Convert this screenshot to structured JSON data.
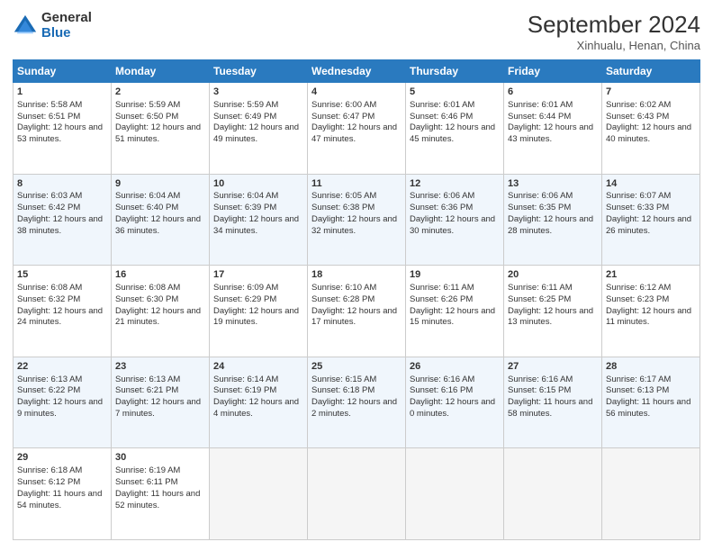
{
  "header": {
    "logo_general": "General",
    "logo_blue": "Blue",
    "month_title": "September 2024",
    "subtitle": "Xinhualu, Henan, China"
  },
  "days_of_week": [
    "Sunday",
    "Monday",
    "Tuesday",
    "Wednesday",
    "Thursday",
    "Friday",
    "Saturday"
  ],
  "weeks": [
    [
      {
        "day": "1",
        "sunrise": "5:58 AM",
        "sunset": "6:51 PM",
        "daylight": "12 hours and 53 minutes."
      },
      {
        "day": "2",
        "sunrise": "5:59 AM",
        "sunset": "6:50 PM",
        "daylight": "12 hours and 51 minutes."
      },
      {
        "day": "3",
        "sunrise": "5:59 AM",
        "sunset": "6:49 PM",
        "daylight": "12 hours and 49 minutes."
      },
      {
        "day": "4",
        "sunrise": "6:00 AM",
        "sunset": "6:47 PM",
        "daylight": "12 hours and 47 minutes."
      },
      {
        "day": "5",
        "sunrise": "6:01 AM",
        "sunset": "6:46 PM",
        "daylight": "12 hours and 45 minutes."
      },
      {
        "day": "6",
        "sunrise": "6:01 AM",
        "sunset": "6:44 PM",
        "daylight": "12 hours and 43 minutes."
      },
      {
        "day": "7",
        "sunrise": "6:02 AM",
        "sunset": "6:43 PM",
        "daylight": "12 hours and 40 minutes."
      }
    ],
    [
      {
        "day": "8",
        "sunrise": "6:03 AM",
        "sunset": "6:42 PM",
        "daylight": "12 hours and 38 minutes."
      },
      {
        "day": "9",
        "sunrise": "6:04 AM",
        "sunset": "6:40 PM",
        "daylight": "12 hours and 36 minutes."
      },
      {
        "day": "10",
        "sunrise": "6:04 AM",
        "sunset": "6:39 PM",
        "daylight": "12 hours and 34 minutes."
      },
      {
        "day": "11",
        "sunrise": "6:05 AM",
        "sunset": "6:38 PM",
        "daylight": "12 hours and 32 minutes."
      },
      {
        "day": "12",
        "sunrise": "6:06 AM",
        "sunset": "6:36 PM",
        "daylight": "12 hours and 30 minutes."
      },
      {
        "day": "13",
        "sunrise": "6:06 AM",
        "sunset": "6:35 PM",
        "daylight": "12 hours and 28 minutes."
      },
      {
        "day": "14",
        "sunrise": "6:07 AM",
        "sunset": "6:33 PM",
        "daylight": "12 hours and 26 minutes."
      }
    ],
    [
      {
        "day": "15",
        "sunrise": "6:08 AM",
        "sunset": "6:32 PM",
        "daylight": "12 hours and 24 minutes."
      },
      {
        "day": "16",
        "sunrise": "6:08 AM",
        "sunset": "6:30 PM",
        "daylight": "12 hours and 21 minutes."
      },
      {
        "day": "17",
        "sunrise": "6:09 AM",
        "sunset": "6:29 PM",
        "daylight": "12 hours and 19 minutes."
      },
      {
        "day": "18",
        "sunrise": "6:10 AM",
        "sunset": "6:28 PM",
        "daylight": "12 hours and 17 minutes."
      },
      {
        "day": "19",
        "sunrise": "6:11 AM",
        "sunset": "6:26 PM",
        "daylight": "12 hours and 15 minutes."
      },
      {
        "day": "20",
        "sunrise": "6:11 AM",
        "sunset": "6:25 PM",
        "daylight": "12 hours and 13 minutes."
      },
      {
        "day": "21",
        "sunrise": "6:12 AM",
        "sunset": "6:23 PM",
        "daylight": "12 hours and 11 minutes."
      }
    ],
    [
      {
        "day": "22",
        "sunrise": "6:13 AM",
        "sunset": "6:22 PM",
        "daylight": "12 hours and 9 minutes."
      },
      {
        "day": "23",
        "sunrise": "6:13 AM",
        "sunset": "6:21 PM",
        "daylight": "12 hours and 7 minutes."
      },
      {
        "day": "24",
        "sunrise": "6:14 AM",
        "sunset": "6:19 PM",
        "daylight": "12 hours and 4 minutes."
      },
      {
        "day": "25",
        "sunrise": "6:15 AM",
        "sunset": "6:18 PM",
        "daylight": "12 hours and 2 minutes."
      },
      {
        "day": "26",
        "sunrise": "6:16 AM",
        "sunset": "6:16 PM",
        "daylight": "12 hours and 0 minutes."
      },
      {
        "day": "27",
        "sunrise": "6:16 AM",
        "sunset": "6:15 PM",
        "daylight": "11 hours and 58 minutes."
      },
      {
        "day": "28",
        "sunrise": "6:17 AM",
        "sunset": "6:13 PM",
        "daylight": "11 hours and 56 minutes."
      }
    ],
    [
      {
        "day": "29",
        "sunrise": "6:18 AM",
        "sunset": "6:12 PM",
        "daylight": "11 hours and 54 minutes."
      },
      {
        "day": "30",
        "sunrise": "6:19 AM",
        "sunset": "6:11 PM",
        "daylight": "11 hours and 52 minutes."
      },
      null,
      null,
      null,
      null,
      null
    ]
  ]
}
